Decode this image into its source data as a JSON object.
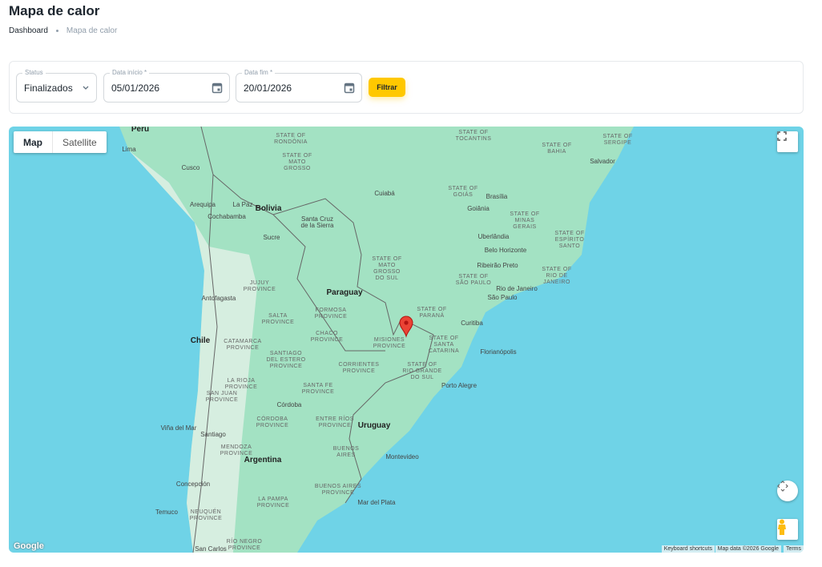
{
  "page": {
    "title": "Mapa de calor"
  },
  "breadcrumb": [
    {
      "label": "Dashboard"
    },
    {
      "label": "Mapa de calor"
    }
  ],
  "filters": {
    "status": {
      "label": "Status",
      "value": "Finalizados"
    },
    "start": {
      "label": "Data início *",
      "value": "05/01/2026"
    },
    "end": {
      "label": "Data fim *",
      "value": "20/01/2026"
    },
    "submit_label": "Filtrar"
  },
  "map": {
    "type_buttons": [
      {
        "label": "Map",
        "selected": true
      },
      {
        "label": "Satellite",
        "selected": false
      }
    ],
    "attribution": {
      "shortcuts": "Keyboard shortcuts",
      "data": "Map data ©2026 Google",
      "terms": "Terms"
    },
    "logo": "Google",
    "colors": {
      "ocean": "#6fd3e7",
      "land": "#a3e2c3",
      "marker": "#ea4335"
    },
    "marker": {
      "place": "Misiones Province"
    },
    "labels": {
      "countries": [
        "Peru",
        "Bolivia",
        "Paraguay",
        "Chile",
        "Argentina",
        "Uruguay"
      ],
      "cities": [
        "Lima",
        "Cusco",
        "Arequipa",
        "La Paz",
        "Cochabamba",
        "Santa Cruz\nde la Sierra",
        "Sucre",
        "Antofagasta",
        "Cuiabá",
        "Brasília",
        "Goiânia",
        "Salvador",
        "Uberlândia",
        "Belo Horizonte",
        "Ribeirão Preto",
        "Rio de Janeiro",
        "São Paulo",
        "Curitiba",
        "Florianópolis",
        "Porto Alegre",
        "Córdoba",
        "Viña del Mar",
        "Santiago",
        "Montevideo",
        "Concepción",
        "Mar del Plata",
        "Temuco",
        "San Carlos"
      ],
      "states": [
        "STATE OF\nRONDÔNIA",
        "STATE OF\nMATO\nGROSSO",
        "STATE OF\nTOCANTINS",
        "STATE OF\nBAHIA",
        "STATE OF\nSERGIPE",
        "STATE OF\nGOIÁS",
        "STATE OF\nMINAS\nGERAIS",
        "STATE OF\nESPÍRITO\nSANTO",
        "STATE OF\nMATO\nGROSSO\nDO SUL",
        "STATE OF\nSÃO PAULO",
        "STATE OF\nRIO DE\nJANEIRO",
        "STATE OF\nPARANÁ",
        "STATE OF\nSANTA\nCATARINA",
        "STATE OF\nRIO GRANDE\nDO SUL",
        "MISIONES\nPROVINCE",
        "JUJUY\nPROVINCE",
        "SALTA\nPROVINCE",
        "FORMOSA\nPROVINCE",
        "CHACO\nPROVINCE",
        "CATAMARCA\nPROVINCE",
        "SANTIAGO\nDEL ESTERO\nPROVINCE",
        "CORRIENTES\nPROVINCE",
        "LA RIOJA\nPROVINCE",
        "SAN JUAN\nPROVINCE",
        "SANTA FE\nPROVINCE",
        "CÓRDOBA\nPROVINCE",
        "ENTRE RÍOS\nPROVINCE",
        "MENDOZA\nPROVINCE",
        "BUENOS\nAIRES",
        "BUENOS AIRES\nPROVINCE",
        "LA PAMPA\nPROVINCE",
        "NEUQUÉN\nPROVINCE",
        "RÍO NEGRO\nPROVINCE"
      ]
    }
  }
}
